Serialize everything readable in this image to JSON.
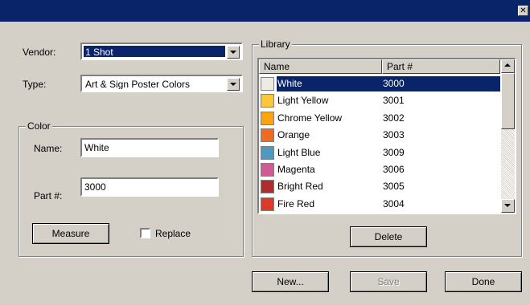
{
  "window": {
    "title": "",
    "close_glyph": "✕"
  },
  "vendor": {
    "label": "Vendor:",
    "value": "1 Shot"
  },
  "type": {
    "label": "Type:",
    "value": "Art & Sign Poster Colors"
  },
  "color_group": {
    "legend": "Color",
    "name_label": "Name:",
    "name_value": "White",
    "part_label": "Part #:",
    "part_value": "3000",
    "measure_label": "Measure",
    "replace_label": "Replace"
  },
  "library": {
    "legend": "Library",
    "columns": [
      "Name",
      "Part #"
    ],
    "rows": [
      {
        "name": "White",
        "part": "3000",
        "color": "#eeeae4",
        "selected": true
      },
      {
        "name": "Light Yellow",
        "part": "3001",
        "color": "#fdc63b"
      },
      {
        "name": "Chrome Yellow",
        "part": "3002",
        "color": "#fca312"
      },
      {
        "name": "Orange",
        "part": "3003",
        "color": "#ef6b22"
      },
      {
        "name": "Light Blue",
        "part": "3009",
        "color": "#4b9bc0"
      },
      {
        "name": "Magenta",
        "part": "3006",
        "color": "#d05a93"
      },
      {
        "name": "Bright Red",
        "part": "3005",
        "color": "#ad2e2e"
      },
      {
        "name": "Fire Red",
        "part": "3004",
        "color": "#dd3a2d"
      }
    ],
    "delete_label": "Delete"
  },
  "footer": {
    "new_label": "New...",
    "save_label": "Save",
    "done_label": "Done"
  }
}
